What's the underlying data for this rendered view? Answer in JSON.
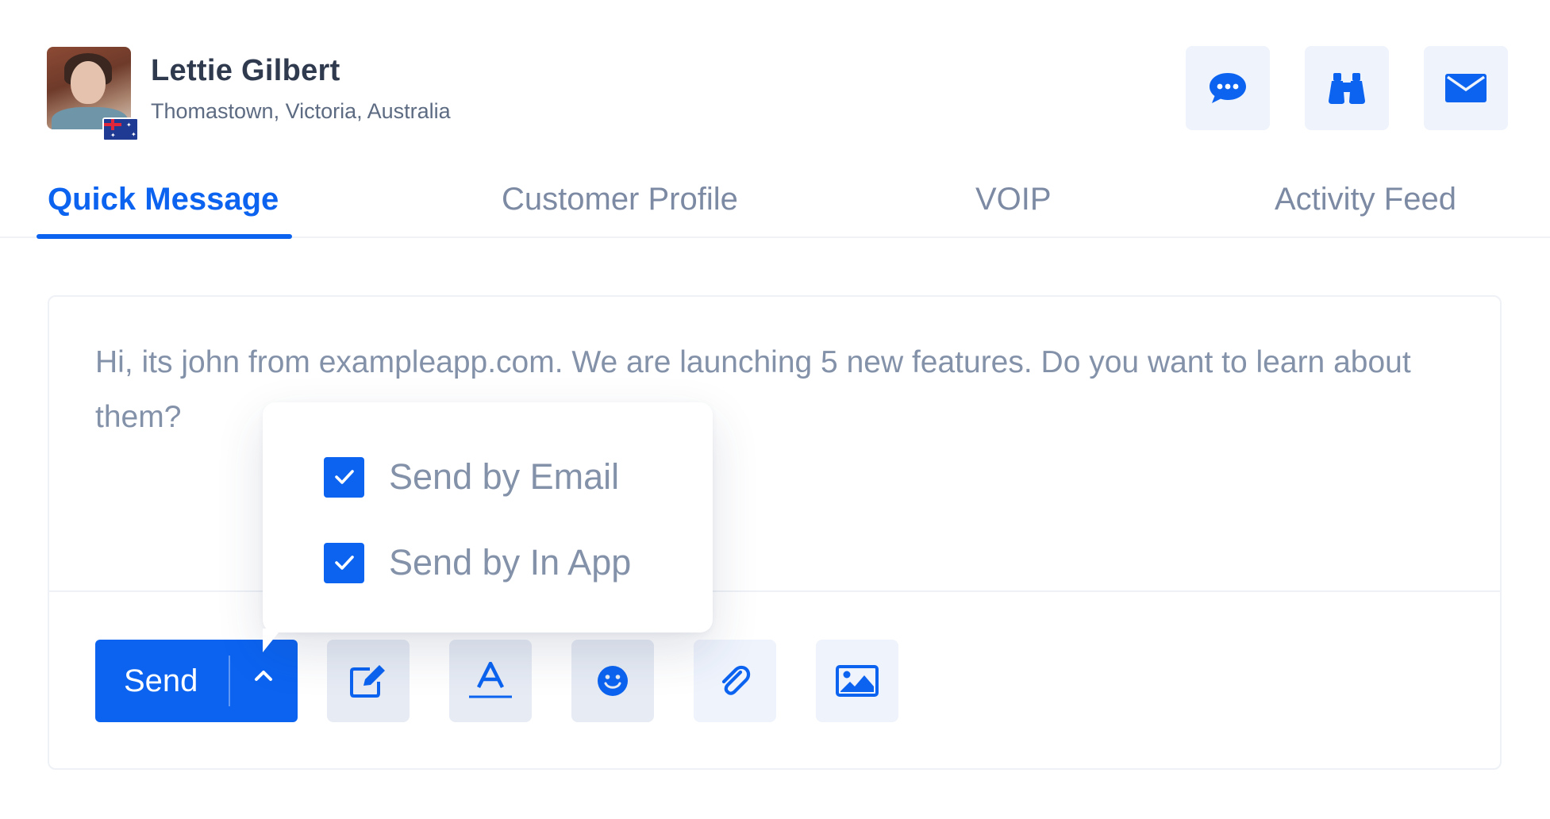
{
  "contact": {
    "name": "Lettie Gilbert",
    "location": "Thomastown, Victoria, Australia",
    "flag": "australia-flag"
  },
  "header_actions": [
    {
      "icon": "chat-bubble-icon",
      "color": "#0b63f0"
    },
    {
      "icon": "binoculars-icon",
      "color": "#0b63f0"
    },
    {
      "icon": "envelope-icon",
      "color": "#0b63f0"
    }
  ],
  "tabs": [
    {
      "label": "Quick Message",
      "active": true
    },
    {
      "label": "Customer Profile",
      "active": false
    },
    {
      "label": "VOIP",
      "active": false
    },
    {
      "label": "Activity Feed",
      "active": false
    }
  ],
  "compose": {
    "message": "Hi, its john from exampleapp.com. We are launching 5 new features. Do you want to learn about them?"
  },
  "send": {
    "label": "Send",
    "menu_open": true,
    "options": [
      {
        "label": "Send by Email",
        "checked": true
      },
      {
        "label": "Send by In App",
        "checked": true
      }
    ]
  },
  "toolbar": [
    {
      "icon": "edit-icon"
    },
    {
      "icon": "text-format-icon"
    },
    {
      "icon": "emoji-icon"
    },
    {
      "icon": "attachment-icon"
    },
    {
      "icon": "image-icon"
    }
  ],
  "colors": {
    "accent": "#0b63f0",
    "icon_button_bg": "#eef3fc",
    "muted_text": "#8391a9",
    "heading_text": "#2f3a4f"
  }
}
